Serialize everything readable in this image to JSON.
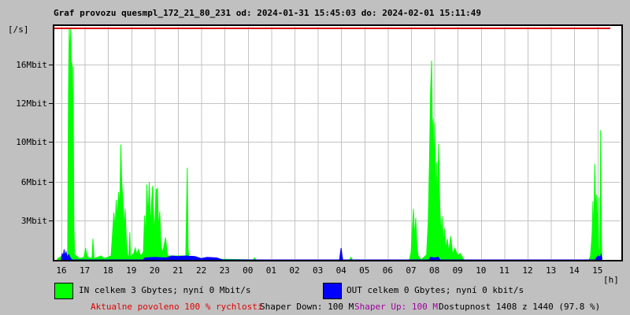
{
  "title": "Graf provozu quesmpl_172_21_80_231 od: 2024-01-31 15:45:03 do: 2024-02-01 15:11:49",
  "y_unit_label": "[/s]",
  "x_unit_label": "[h]",
  "legend": {
    "in_label": "IN celkem 3 Gbytes; nyní 0 Mbit/s",
    "out_label": "OUT celkem 0 Gbytes; nyní 0 kbit/s"
  },
  "status": {
    "allowed": "Aktualne povoleno 100 % rychlosti",
    "shaper_down": "Shaper Down: 100 M",
    "shaper_up": "Shaper Up: 100 M",
    "availability": "Dostupnost 1408 z 1440 (97.8 %)"
  },
  "colors": {
    "background": "#c0c0c0",
    "plot_background": "#ffffff",
    "grid": "#c3c3c3",
    "border": "#000000",
    "text": "#000000",
    "in_series": "#00ff00",
    "out_series": "#0000ff",
    "limit_line": "#dd0000",
    "status_allowed_text": "#e00000",
    "status_shaper_up_text": "#a000a0"
  },
  "chart_data": {
    "type": "area",
    "title": "Graf provozu quesmpl_172_21_80_231",
    "time_range": {
      "from": "2024-01-31 15:45:03",
      "to": "2024-02-01 15:11:49"
    },
    "x_axis": {
      "unit": "[h]",
      "tick_labels": [
        "16",
        "17",
        "18",
        "19",
        "20",
        "21",
        "22",
        "23",
        "00",
        "01",
        "02",
        "03",
        "04",
        "05",
        "06",
        "07",
        "08",
        "09",
        "10",
        "11",
        "12",
        "13",
        "14",
        "15"
      ]
    },
    "y_axis": {
      "unit": "[/s]",
      "tick_labels": [
        "16Mbit",
        "12Mbit",
        "10Mbit",
        "6Mbit",
        "3Mbit"
      ],
      "tick_values_mbit": [
        16,
        12,
        10,
        6,
        3
      ],
      "max_mbit": 20
    },
    "grid": true,
    "legend_position": "bottom",
    "series": [
      {
        "name": "IN",
        "unit": "Mbit/s",
        "points": [
          [
            "15:50",
            0.1
          ],
          [
            "16:02",
            0.3
          ],
          [
            "16:06",
            0.1
          ],
          [
            "16:10",
            0.4
          ],
          [
            "16:14",
            0.2
          ],
          [
            "16:16",
            0.5
          ],
          [
            "16:18",
            13
          ],
          [
            "16:20",
            19.8
          ],
          [
            "16:22",
            16.5
          ],
          [
            "16:24",
            19.8
          ],
          [
            "16:26",
            14
          ],
          [
            "16:27",
            16.2
          ],
          [
            "16:29",
            8
          ],
          [
            "16:30",
            15.8
          ],
          [
            "16:32",
            2.5
          ],
          [
            "16:34",
            0.4
          ],
          [
            "16:46",
            0.1
          ],
          [
            "16:58",
            0.2
          ],
          [
            "17:02",
            0.9
          ],
          [
            "17:06",
            0.3
          ],
          [
            "17:12",
            0.1
          ],
          [
            "17:19",
            0.2
          ],
          [
            "17:21",
            1.6
          ],
          [
            "17:24",
            0.1
          ],
          [
            "17:42",
            0.3
          ],
          [
            "17:50",
            0.1
          ],
          [
            "18:08",
            0.3
          ],
          [
            "18:12",
            2.2
          ],
          [
            "18:15",
            3.6
          ],
          [
            "18:18",
            2.4
          ],
          [
            "18:21",
            4.6
          ],
          [
            "18:24",
            3.0
          ],
          [
            "18:27",
            5.2
          ],
          [
            "18:30",
            4.0
          ],
          [
            "18:33",
            9.7
          ],
          [
            "18:35",
            6.1
          ],
          [
            "18:38",
            4.7
          ],
          [
            "18:41",
            2.3
          ],
          [
            "18:44",
            3.9
          ],
          [
            "18:47",
            1.5
          ],
          [
            "18:50",
            0.4
          ],
          [
            "18:54",
            0.2
          ],
          [
            "18:56",
            2.1
          ],
          [
            "18:58",
            0.2
          ],
          [
            "19:06",
            0.5
          ],
          [
            "19:10",
            0.9
          ],
          [
            "19:14",
            0.4
          ],
          [
            "19:18",
            0.8
          ],
          [
            "19:24",
            0.3
          ],
          [
            "19:31",
            0.6
          ],
          [
            "19:34",
            3.4
          ],
          [
            "19:37",
            1.7
          ],
          [
            "19:40",
            5.8
          ],
          [
            "19:43",
            3.1
          ],
          [
            "19:46",
            6.0
          ],
          [
            "19:49",
            2.5
          ],
          [
            "19:52",
            4.4
          ],
          [
            "19:55",
            5.7
          ],
          [
            "19:58",
            2.0
          ],
          [
            "20:01",
            3.3
          ],
          [
            "20:04",
            5.4
          ],
          [
            "20:07",
            5.5
          ],
          [
            "20:10",
            2.2
          ],
          [
            "20:13",
            3.7
          ],
          [
            "20:16",
            1.2
          ],
          [
            "20:20",
            0.5
          ],
          [
            "20:28",
            1.7
          ],
          [
            "20:33",
            0.3
          ],
          [
            "21:20",
            0.3
          ],
          [
            "21:24",
            7.4
          ],
          [
            "21:26",
            0.9
          ],
          [
            "21:28",
            0.1
          ],
          [
            "00:14",
            0
          ],
          [
            "00:17",
            0.15
          ],
          [
            "00:21",
            0
          ],
          [
            "04:22",
            0
          ],
          [
            "04:25",
            0.2
          ],
          [
            "04:29",
            0
          ],
          [
            "06:56",
            0
          ],
          [
            "07:00",
            0.6
          ],
          [
            "07:03",
            2.2
          ],
          [
            "07:06",
            3.9
          ],
          [
            "07:09",
            1.6
          ],
          [
            "07:12",
            3.2
          ],
          [
            "07:15",
            1.1
          ],
          [
            "07:18",
            0.3
          ],
          [
            "07:26",
            0
          ],
          [
            "07:40",
            0.4
          ],
          [
            "07:44",
            2.8
          ],
          [
            "07:47",
            7.5
          ],
          [
            "07:50",
            13
          ],
          [
            "07:53",
            16.4
          ],
          [
            "07:55",
            9
          ],
          [
            "07:57",
            11.2
          ],
          [
            "07:59",
            6.5
          ],
          [
            "08:01",
            11
          ],
          [
            "08:03",
            4.2
          ],
          [
            "08:06",
            8
          ],
          [
            "08:08",
            3.5
          ],
          [
            "08:11",
            9.8
          ],
          [
            "08:14",
            4
          ],
          [
            "08:17",
            2
          ],
          [
            "08:20",
            3.3
          ],
          [
            "08:23",
            1.2
          ],
          [
            "08:26",
            2.4
          ],
          [
            "08:29",
            0.8
          ],
          [
            "08:33",
            1.6
          ],
          [
            "08:37",
            0.6
          ],
          [
            "08:42",
            1.8
          ],
          [
            "08:47",
            0.4
          ],
          [
            "08:53",
            0.9
          ],
          [
            "09:00",
            0.3
          ],
          [
            "09:06",
            0.5
          ],
          [
            "09:12",
            0.2
          ],
          [
            "09:16",
            0
          ],
          [
            "14:38",
            0
          ],
          [
            "14:42",
            0.3
          ],
          [
            "14:46",
            2.0
          ],
          [
            "14:48",
            4.5
          ],
          [
            "14:50",
            1.5
          ],
          [
            "14:53",
            7.8
          ],
          [
            "14:55",
            3.5
          ],
          [
            "14:57",
            5.0
          ],
          [
            "14:59",
            1.8
          ],
          [
            "15:01",
            4.8
          ],
          [
            "15:03",
            0.8
          ],
          [
            "15:06",
            0.5
          ],
          [
            "15:08",
            10.6
          ],
          [
            "15:10",
            1.8
          ],
          [
            "15:11",
            0.2
          ]
        ]
      },
      {
        "name": "OUT",
        "unit": "Mbit/s",
        "points": [
          [
            "16:00",
            0.1
          ],
          [
            "16:02",
            0.5
          ],
          [
            "16:04",
            0.2
          ],
          [
            "16:07",
            0.8
          ],
          [
            "16:09",
            0.3
          ],
          [
            "16:12",
            0.6
          ],
          [
            "16:15",
            0.2
          ],
          [
            "16:19",
            0.4
          ],
          [
            "16:23",
            0.15
          ],
          [
            "16:28",
            0
          ],
          [
            "19:30",
            0
          ],
          [
            "19:35",
            0.15
          ],
          [
            "20:00",
            0.2
          ],
          [
            "20:30",
            0.15
          ],
          [
            "20:44",
            0.3
          ],
          [
            "21:00",
            0.25
          ],
          [
            "21:20",
            0.3
          ],
          [
            "21:44",
            0.25
          ],
          [
            "22:00",
            0.1
          ],
          [
            "22:15",
            0.2
          ],
          [
            "22:40",
            0.15
          ],
          [
            "22:55",
            0
          ],
          [
            "03:56",
            0
          ],
          [
            "03:58",
            0.5
          ],
          [
            "04:00",
            0.9
          ],
          [
            "04:02",
            0.4
          ],
          [
            "04:04",
            0
          ],
          [
            "07:46",
            0
          ],
          [
            "07:50",
            0.2
          ],
          [
            "08:00",
            0.15
          ],
          [
            "08:10",
            0.2
          ],
          [
            "08:15",
            0
          ],
          [
            "14:54",
            0
          ],
          [
            "14:58",
            0.2
          ],
          [
            "15:03",
            0.3
          ],
          [
            "15:07",
            0.2
          ],
          [
            "15:09",
            0.4
          ],
          [
            "15:11",
            0.2
          ]
        ]
      }
    ],
    "limit_line": {
      "value": "top of scale",
      "color": "#dd0000"
    }
  }
}
